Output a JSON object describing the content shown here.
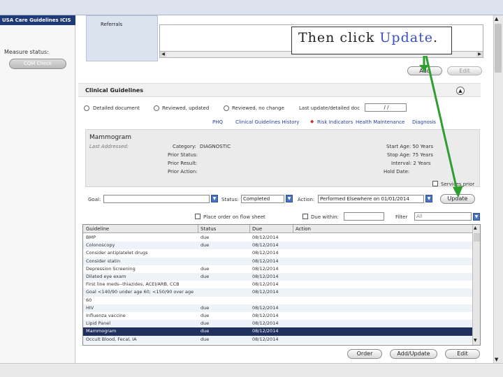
{
  "app": {
    "title": "USA Care Guidelines ICIS"
  },
  "left_panel": {
    "measure_status_label": "Measure status:",
    "cqm_button": "CQM Check"
  },
  "referrals": {
    "label": "Referrals",
    "add_button": "Add",
    "edit_button": "Edit"
  },
  "callout": {
    "prefix": "Then click ",
    "highlight": "Update",
    "suffix": "."
  },
  "clinical": {
    "section_title": "Clinical Guidelines",
    "expand_symbol": "▲",
    "radios": [
      "Detailed document",
      "Reviewed, updated",
      "Reviewed, no change"
    ],
    "last_update_label": "Last update/detailed doc",
    "last_update_value": "/ /",
    "links": [
      "PHQ",
      "Clinical Guidelines History",
      "Risk Indicators",
      "Health Maintenance",
      "Diagnosis"
    ],
    "risk_marker": "◆",
    "measure": {
      "name": "Mammogram",
      "last_addressed": "Last Addressed:",
      "category_label": "Category:",
      "category_value": "DIAGNOSTIC",
      "prior_status_label": "Prior Status:",
      "prior_result_label": "Prior Result:",
      "prior_action_label": "Prior Action:",
      "start_age": "Start Age: 50 Years",
      "stop_age": "Stop Age: 75 Years",
      "interval": "Interval: 2 Years",
      "hold_date": "Hold Date:",
      "services_prior": "Services prior"
    },
    "goal_label": "Goal:",
    "goal_value": "",
    "status_label": "Status:",
    "status_value": "Completed",
    "action_label": "Action:",
    "action_value": "Performed Elsewhere on 01/01/2014",
    "update_button": "Update",
    "place_order_label": "Place order on flow sheet",
    "due_within_label": "Due within:",
    "filter_label": "Filter",
    "filter_value": "All"
  },
  "grid": {
    "headers": [
      "Guideline",
      "Status",
      "Due",
      "Action"
    ],
    "rows": [
      {
        "g": "BMP",
        "s": "due",
        "d": "08/12/2014"
      },
      {
        "g": "Colonoscopy",
        "s": "due",
        "d": "08/12/2014"
      },
      {
        "g": "Consider antiplatelet drugs",
        "s": "",
        "d": "08/12/2014"
      },
      {
        "g": "Consider statin",
        "s": "",
        "d": "08/12/2014"
      },
      {
        "g": "Depression Screening",
        "s": "due",
        "d": "08/12/2014"
      },
      {
        "g": "Dilated eye exam",
        "s": "due",
        "d": "08/12/2014"
      },
      {
        "g": "First line meds--thiazides, ACEI/ARB, CCB",
        "s": "",
        "d": "08/12/2014"
      },
      {
        "g": "Goal <140/90 under age 60; <150/90 over age",
        "s": "",
        "d": "08/12/2014"
      },
      {
        "g": "60",
        "s": "",
        "d": ""
      },
      {
        "g": "HIV",
        "s": "due",
        "d": "08/12/2014"
      },
      {
        "g": "Influenza vaccine",
        "s": "due",
        "d": "08/12/2014"
      },
      {
        "g": "Lipid Panel",
        "s": "due",
        "d": "08/12/2014"
      },
      {
        "g": "Mammogram",
        "s": "due",
        "d": "08/12/2014"
      },
      {
        "g": "Occult Blood, Fecal, IA",
        "s": "due",
        "d": "08/12/2014"
      }
    ]
  },
  "footer_buttons": {
    "order": "Order",
    "add_update": "Add/Update",
    "edit": "Edit"
  },
  "colors": {
    "arrow": "#2e9e2e",
    "selected_row": "#1f2f5e",
    "accent": "#4a73c4"
  }
}
